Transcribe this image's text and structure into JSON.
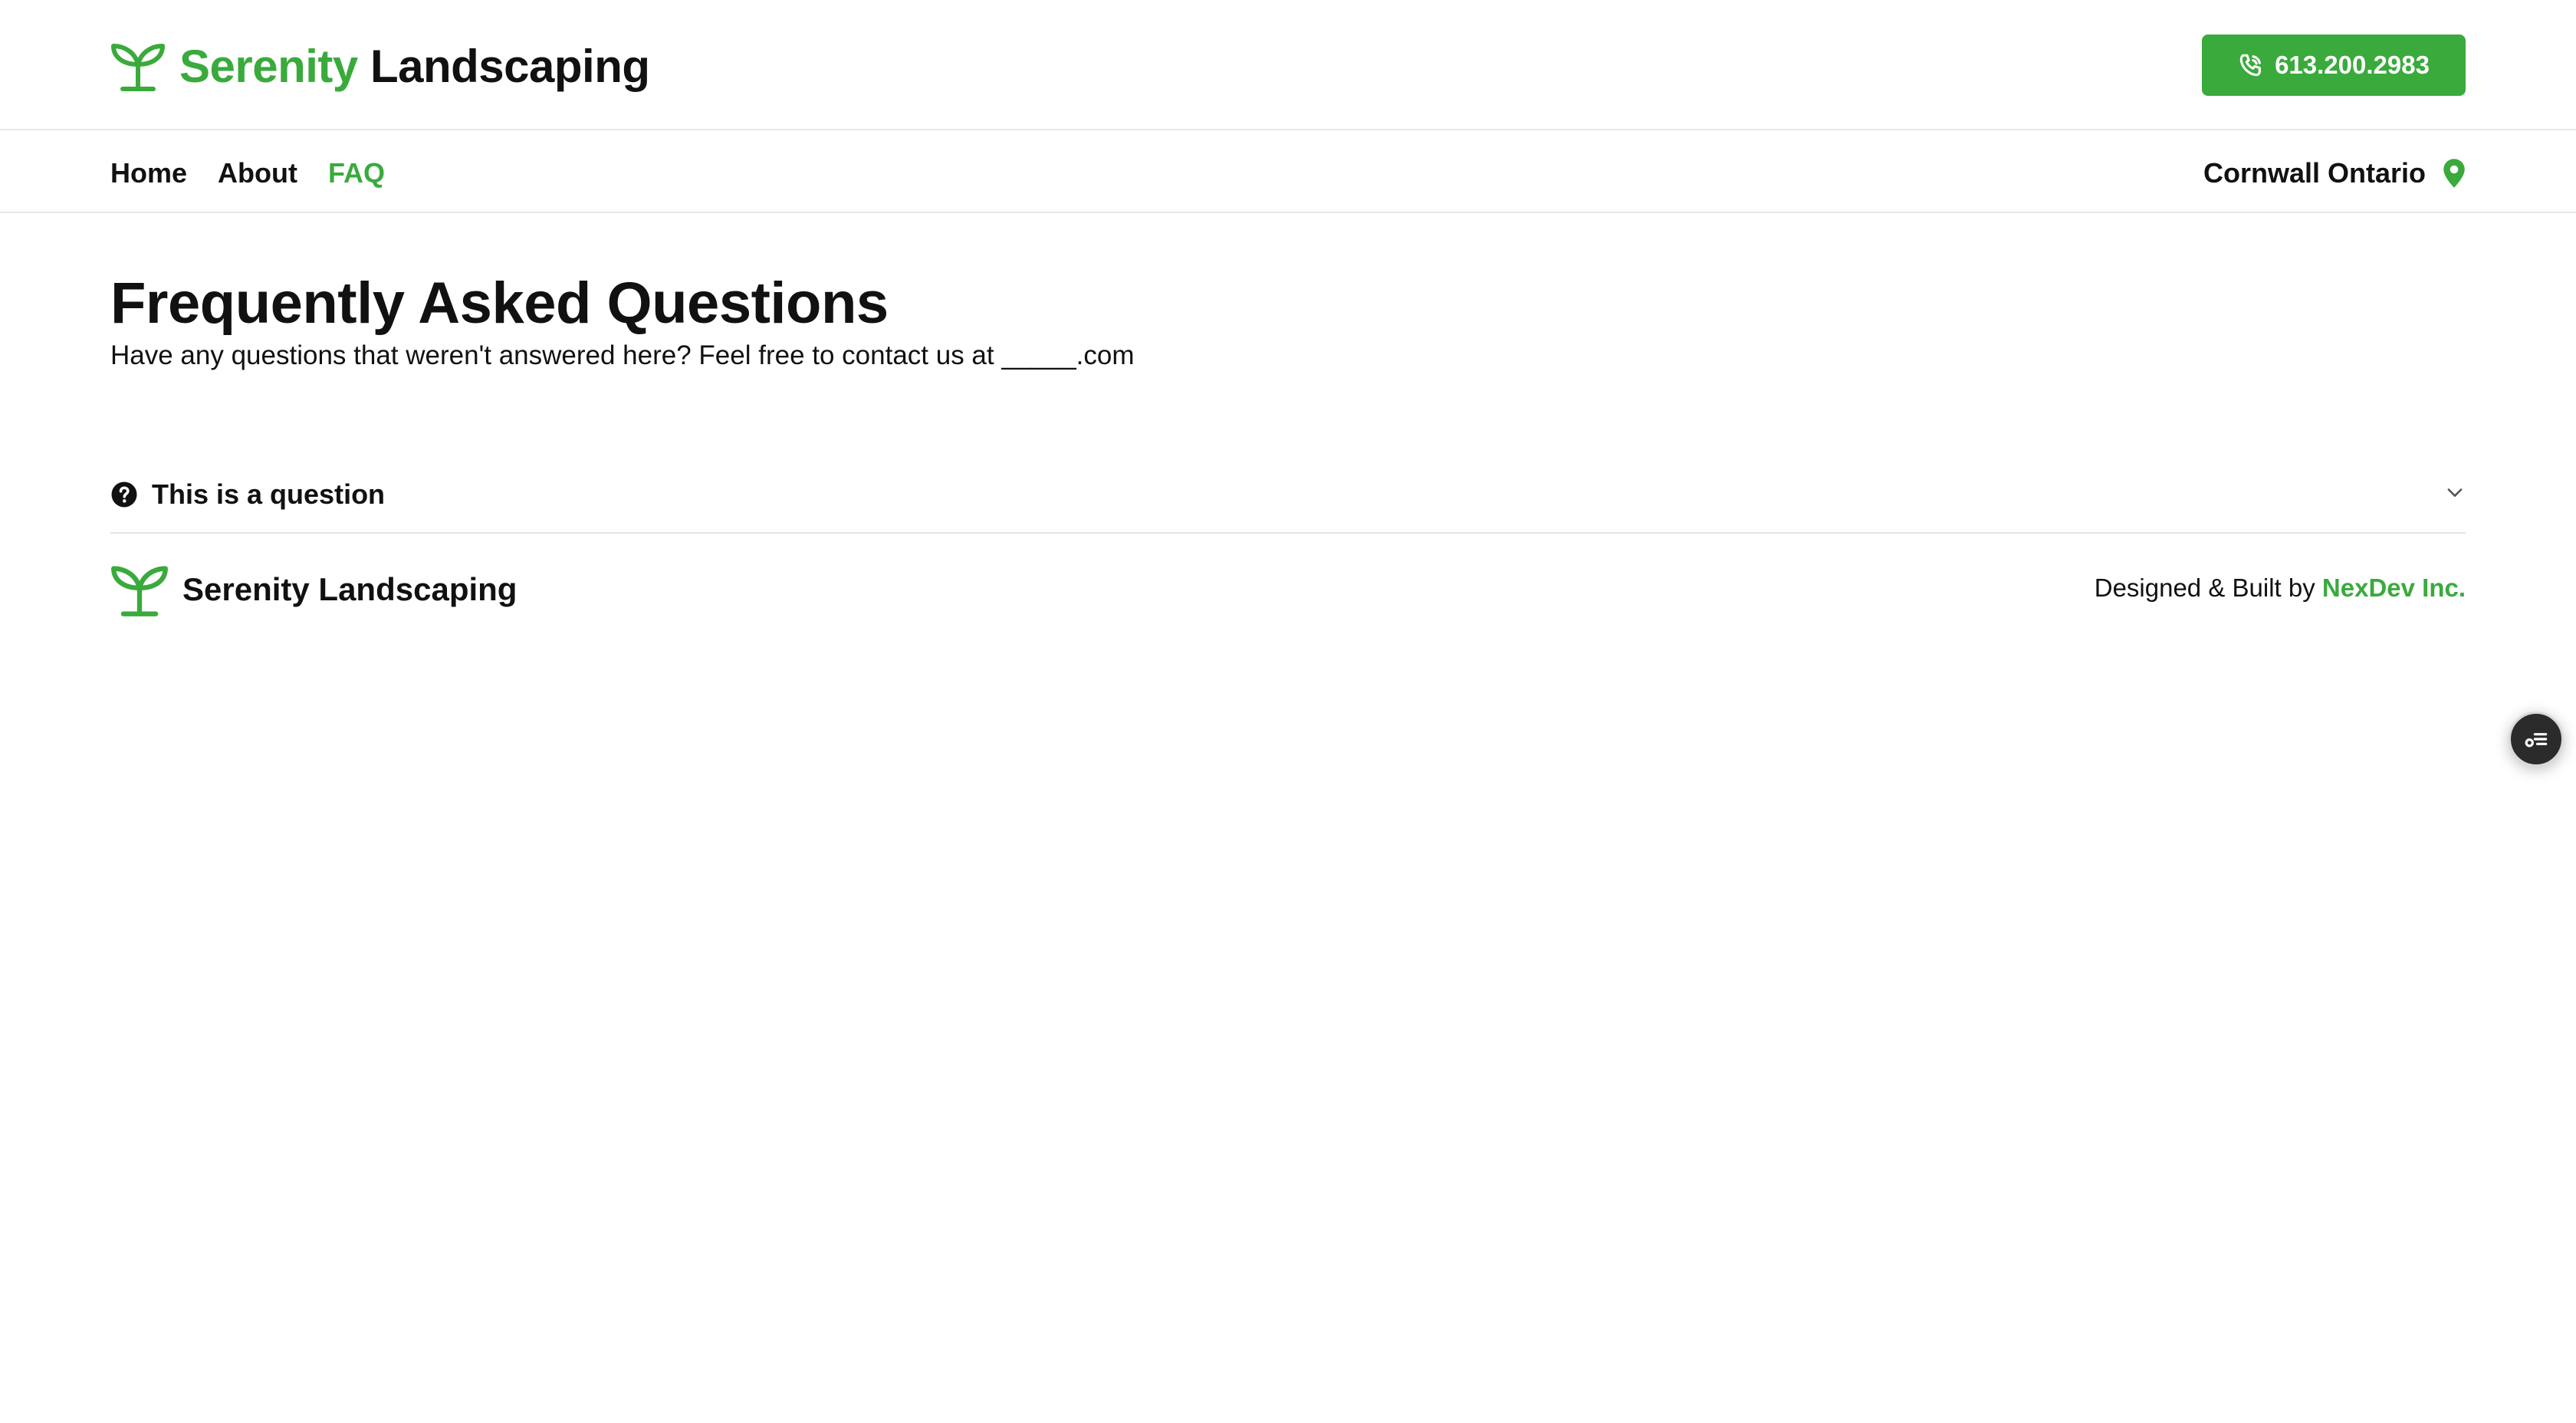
{
  "header": {
    "brand": {
      "first": "Serenity",
      "second": "Landscaping",
      "icon": "sprout-icon"
    },
    "phone": {
      "label": "613.200.2983",
      "icon": "phone-icon"
    }
  },
  "nav": {
    "links": [
      {
        "label": "Home",
        "active": false
      },
      {
        "label": "About",
        "active": false
      },
      {
        "label": "FAQ",
        "active": true
      }
    ],
    "location": {
      "label": "Cornwall Ontario",
      "icon": "map-pin-icon"
    }
  },
  "main": {
    "title": "Frequently Asked Questions",
    "subtitle": "Have any questions that weren't answered here? Feel free to contact us at _____.com",
    "faq_items": [
      {
        "question": "This is a question",
        "icon": "question-circle-icon",
        "expanded": false
      }
    ]
  },
  "footer": {
    "brand": "Serenity Landscaping",
    "credit_prefix": "Designed & Built by ",
    "credit_link": "NexDev Inc."
  },
  "widget": {
    "icon": "accessibility-menu-icon"
  },
  "colors": {
    "accent": "#3aaa3c",
    "text": "#111111",
    "border": "#e8e8e8",
    "widget_bg": "#2b2b2b"
  }
}
